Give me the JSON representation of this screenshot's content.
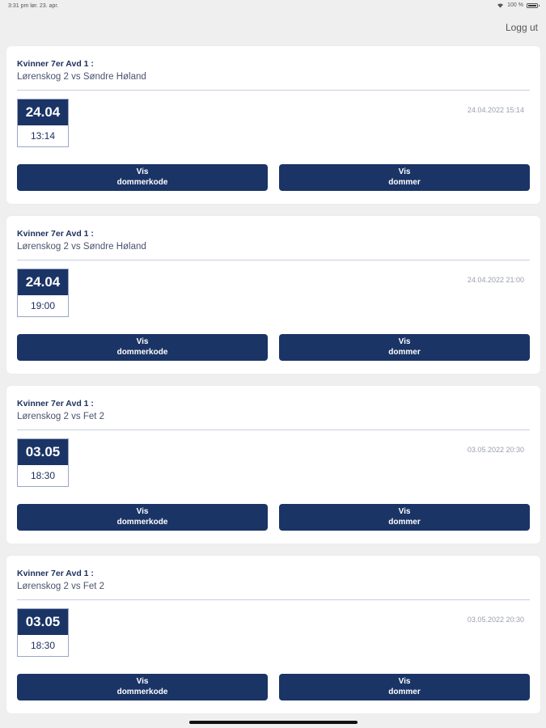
{
  "status_bar": {
    "time_date": "3:31 pm  lør. 23. apr.",
    "battery": "100 %",
    "icons": [
      "wifi-icon",
      "battery-icon"
    ]
  },
  "header": {
    "logout_label": "Logg ut"
  },
  "matches": [
    {
      "league": "Kvinner 7er Avd 1 :",
      "teams": "Lørenskog 2 vs Søndre Høland",
      "date": "24.04",
      "time": "13:14",
      "timestamp": "24.04.2022 15:14",
      "btn_left_line1": "Vis",
      "btn_left_line2": "dommerkode",
      "btn_right_line1": "Vis",
      "btn_right_line2": "dommer"
    },
    {
      "league": "Kvinner 7er Avd 1 :",
      "teams": "Lørenskog 2 vs Søndre Høland",
      "date": "24.04",
      "time": "19:00",
      "timestamp": "24.04.2022 21:00",
      "btn_left_line1": "Vis",
      "btn_left_line2": "dommerkode",
      "btn_right_line1": "Vis",
      "btn_right_line2": "dommer"
    },
    {
      "league": "Kvinner 7er Avd 1 :",
      "teams": "Lørenskog 2 vs Fet 2",
      "date": "03.05",
      "time": "18:30",
      "timestamp": "03.05.2022 20:30",
      "btn_left_line1": "Vis",
      "btn_left_line2": "dommerkode",
      "btn_right_line1": "Vis",
      "btn_right_line2": "dommer"
    },
    {
      "league": "Kvinner 7er Avd 1 :",
      "teams": "Lørenskog 2 vs Fet 2",
      "date": "03.05",
      "time": "18:30",
      "timestamp": "03.05.2022 20:30",
      "btn_left_line1": "Vis",
      "btn_left_line2": "dommerkode",
      "btn_right_line1": "Vis",
      "btn_right_line2": "dommer"
    }
  ],
  "colors": {
    "primary": "#1b3466",
    "background": "#efefef",
    "card": "#ffffff"
  }
}
